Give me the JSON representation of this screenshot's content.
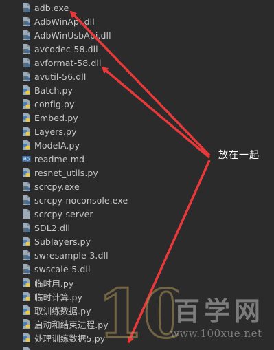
{
  "files": [
    {
      "label": "adb.exe",
      "icon": "executable-file-icon"
    },
    {
      "label": "AdbWinApi.dll",
      "icon": "dll-file-icon"
    },
    {
      "label": "AdbWinUsbApi.dll",
      "icon": "dll-file-icon"
    },
    {
      "label": "avcodec-58.dll",
      "icon": "dll-file-icon"
    },
    {
      "label": "avformat-58.dll",
      "icon": "dll-file-icon"
    },
    {
      "label": "avutil-56.dll",
      "icon": "dll-file-icon"
    },
    {
      "label": "Batch.py",
      "icon": "python-file-icon"
    },
    {
      "label": "config.py",
      "icon": "python-file-icon"
    },
    {
      "label": "Embed.py",
      "icon": "python-file-icon"
    },
    {
      "label": "Layers.py",
      "icon": "python-file-icon"
    },
    {
      "label": "ModelA.py",
      "icon": "python-file-icon"
    },
    {
      "label": "readme.md",
      "icon": "markdown-file-icon"
    },
    {
      "label": "resnet_utils.py",
      "icon": "python-file-icon"
    },
    {
      "label": "scrcpy.exe",
      "icon": "executable-file-icon"
    },
    {
      "label": "scrcpy-noconsole.exe",
      "icon": "executable-file-icon"
    },
    {
      "label": "scrcpy-server",
      "icon": "generic-file-icon"
    },
    {
      "label": "SDL2.dll",
      "icon": "dll-file-icon"
    },
    {
      "label": "Sublayers.py",
      "icon": "python-file-icon"
    },
    {
      "label": "swresample-3.dll",
      "icon": "dll-file-icon"
    },
    {
      "label": "swscale-5.dll",
      "icon": "dll-file-icon"
    },
    {
      "label": "临时用.py",
      "icon": "python-file-icon"
    },
    {
      "label": "临时计算.py",
      "icon": "python-file-icon"
    },
    {
      "label": "取训练数据.py",
      "icon": "python-file-icon"
    },
    {
      "label": "启动和结束进程.py",
      "icon": "python-file-icon"
    },
    {
      "label": "处理训练数据5.py",
      "icon": "python-file-icon"
    },
    {
      "label": "",
      "icon": "python-file-icon"
    }
  ],
  "annotation": {
    "label": "放在一起",
    "arrow_color": "#e8393a"
  },
  "watermark": {
    "logo_text": "100",
    "title": "百学网",
    "url": "www.100xue.net"
  },
  "colors": {
    "background": "#2b2b2b",
    "file_text": "#c7c7c7",
    "python_blue": "#4a7fb5",
    "python_yellow": "#e6c84a"
  }
}
